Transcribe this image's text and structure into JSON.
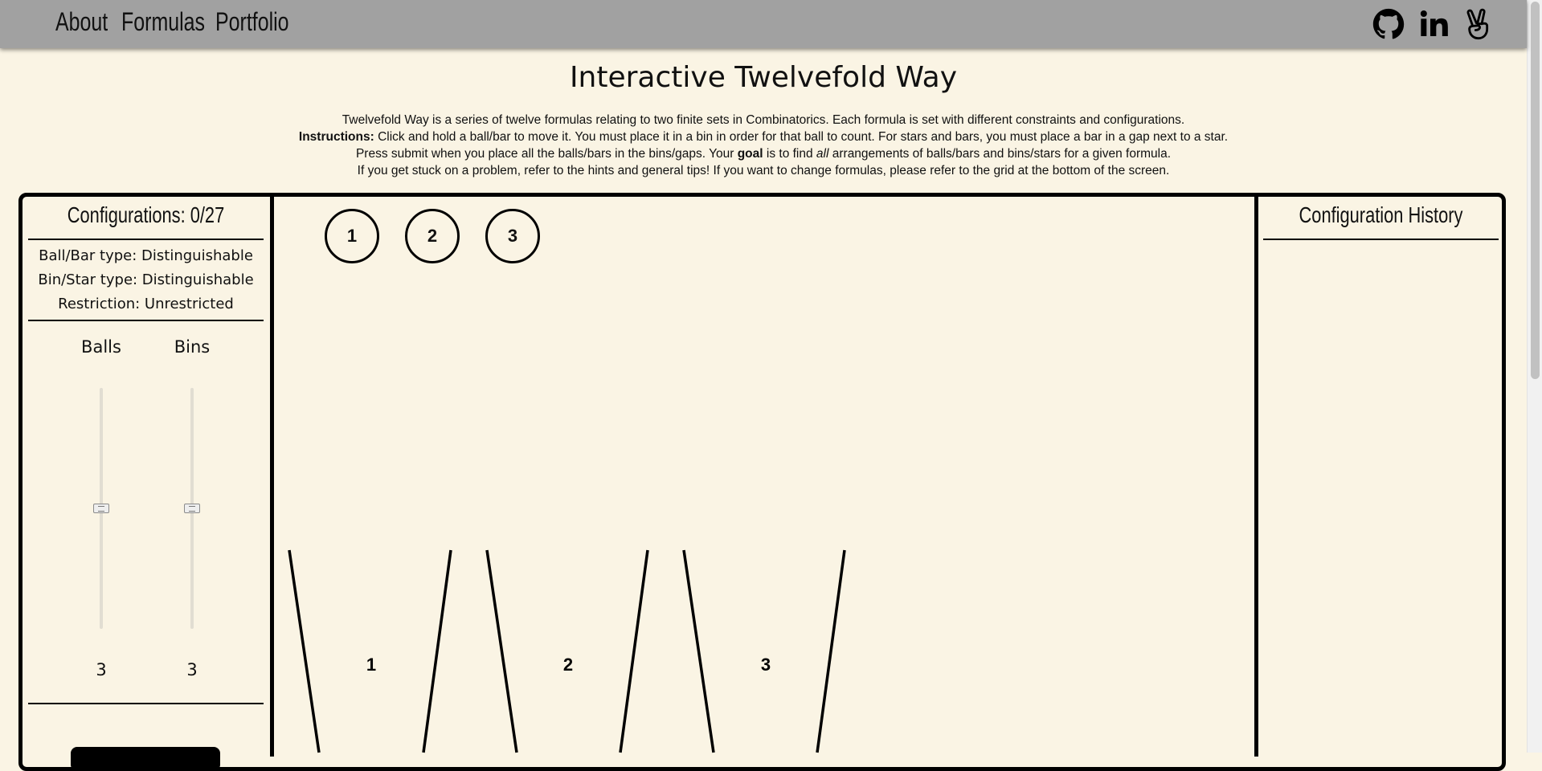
{
  "nav": {
    "links": [
      "About",
      "Formulas",
      "Portfolio"
    ],
    "social_icons": [
      "github-icon",
      "linkedin-icon",
      "peace-sign-icon"
    ]
  },
  "header": {
    "title": "Interactive Twelvefold Way",
    "intro_line1": "Twelvefold Way is a series of twelve formulas relating to two finite sets in Combinatorics. Each formula is set with different constraints and configurations.",
    "instructions_label": "Instructions:",
    "intro_line2": " Click and hold a ball/bar to move it. You must place it in a bin in order for that ball to count. For stars and bars, you must place a bar in a gap next to a star.",
    "intro_line3_a": "Press submit when you place all the balls/bars in the bins/gaps. Your ",
    "goal_label": "goal",
    "intro_line3_b": " is to find ",
    "all_label": "all",
    "intro_line3_c": " arrangements of balls/bars and bins/stars for a given formula.",
    "intro_line4": "If you get stuck on a problem, refer to the hints and general tips! If you want to change formulas, please refer to the grid at the bottom of the screen."
  },
  "left_panel": {
    "configurations_title": "Configurations: 0/27",
    "ball_type": "Ball/Bar type: Distinguishable",
    "bin_type": "Bin/Star type: Distinguishable",
    "restriction": "Restriction: Unrestricted",
    "balls_label": "Balls",
    "bins_label": "Bins",
    "balls_value": "3",
    "bins_value": "3",
    "balls_slider_level": 0.5,
    "bins_slider_level": 0.5
  },
  "workspace": {
    "balls": [
      "1",
      "2",
      "3"
    ],
    "bins": [
      "1",
      "2",
      "3"
    ]
  },
  "right_panel": {
    "title": "Configuration History"
  },
  "colors": {
    "background": "#faf4e4",
    "navbar": "#a1a1a1",
    "ink": "#000000"
  }
}
